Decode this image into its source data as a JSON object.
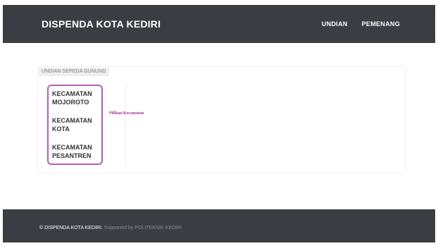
{
  "header": {
    "brand": "DISPENDA KOTA KEDIRI",
    "nav": [
      {
        "label": "UNDIAN"
      },
      {
        "label": "PEMENANG"
      }
    ]
  },
  "panel": {
    "label": "UNDIAN SEPEDA GUNUNG",
    "items": [
      {
        "line1": "KECAMATAN",
        "line2": "MOJOROTO"
      },
      {
        "line1": "KECAMATAN",
        "line2": "KOTA"
      },
      {
        "line1": "KECAMATAN",
        "line2": "PESANTREN"
      }
    ],
    "hint": "Pilihan Kecamatan"
  },
  "footer": {
    "copyright": "© DISPENDA KOTA KEDIRI.",
    "supported": "Supported by POLITEKNIK KEDIRI"
  },
  "colors": {
    "header_bg": "#3a3d42",
    "accent": "#b35fb3"
  }
}
